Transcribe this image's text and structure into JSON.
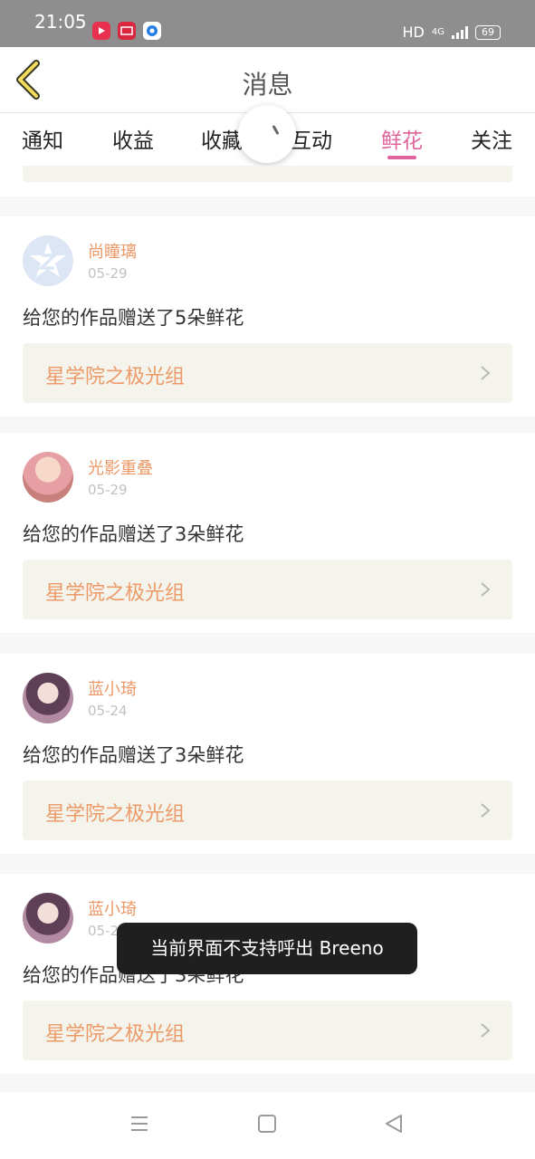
{
  "status_bar": {
    "time": "21:05",
    "hd": "HD",
    "network": "4G",
    "battery": "69",
    "app_icons": [
      "video-app-icon",
      "record-app-icon",
      "browser-app-icon"
    ]
  },
  "header": {
    "title": "消息",
    "back_icon": "chevron-left-icon"
  },
  "tabs": [
    {
      "label": "通知"
    },
    {
      "label": "收益"
    },
    {
      "label": "收藏"
    },
    {
      "label": "互动"
    },
    {
      "label": "鲜花"
    },
    {
      "label": "关注"
    }
  ],
  "active_tab": "鲜花",
  "messages": [
    {
      "user": "尚瞳璃",
      "date": "05-29",
      "text": "给您的作品赠送了5朵鲜花",
      "work": "星学院之极光组"
    },
    {
      "user": "光影重叠",
      "date": "05-29",
      "text": "给您的作品赠送了3朵鲜花",
      "work": "星学院之极光组"
    },
    {
      "user": "蓝小琦",
      "date": "05-24",
      "text": "给您的作品赠送了3朵鲜花",
      "work": "星学院之极光组"
    },
    {
      "user": "蓝小琦",
      "date": "05-2",
      "text": "给您的作品赠送了3朵鲜花",
      "work": "星学院之极光组"
    }
  ],
  "toast": "当前界面不支持呼出 Breeno",
  "nav_bar": [
    "menu-icon",
    "home-square-icon",
    "back-triangle-icon"
  ],
  "colors": {
    "accent": "#e0649c",
    "username": "#eb9866",
    "work_title": "#ec9a68",
    "panel": "#f4f4ec",
    "status_bar": "#8e8e8e"
  }
}
